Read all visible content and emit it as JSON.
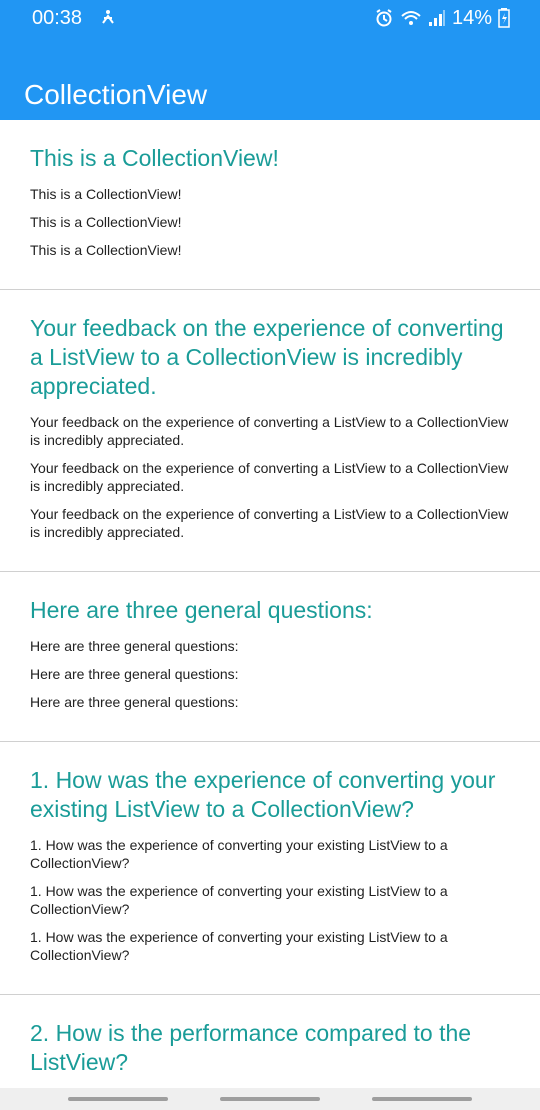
{
  "status": {
    "time": "00:38",
    "battery": "14%"
  },
  "app": {
    "title": "CollectionView"
  },
  "items": [
    {
      "title": "This is a CollectionView!",
      "lines": [
        "This is a CollectionView!",
        "This is a CollectionView!",
        "This is a CollectionView!"
      ]
    },
    {
      "title": "Your feedback on the experience of converting a ListView to a CollectionView is incredibly appreciated.",
      "lines": [
        "Your feedback on the experience of converting a ListView to a CollectionView is incredibly appreciated.",
        "Your feedback on the experience of converting a ListView to a CollectionView is incredibly appreciated.",
        "Your feedback on the experience of converting a ListView to a CollectionView is incredibly appreciated."
      ]
    },
    {
      "title": "Here are three general questions:",
      "lines": [
        "Here are three general questions:",
        "Here are three general questions:",
        "Here are three general questions:"
      ]
    },
    {
      "title": "1. How was the experience of converting your existing ListView to a CollectionView?",
      "lines": [
        "1. How was the experience of converting your existing ListView to a CollectionView?",
        "1. How was the experience of converting your existing ListView to a CollectionView?",
        "1. How was the experience of converting your existing ListView to a CollectionView?"
      ]
    },
    {
      "title": "2. How is the performance compared to the ListView?",
      "lines": []
    }
  ]
}
